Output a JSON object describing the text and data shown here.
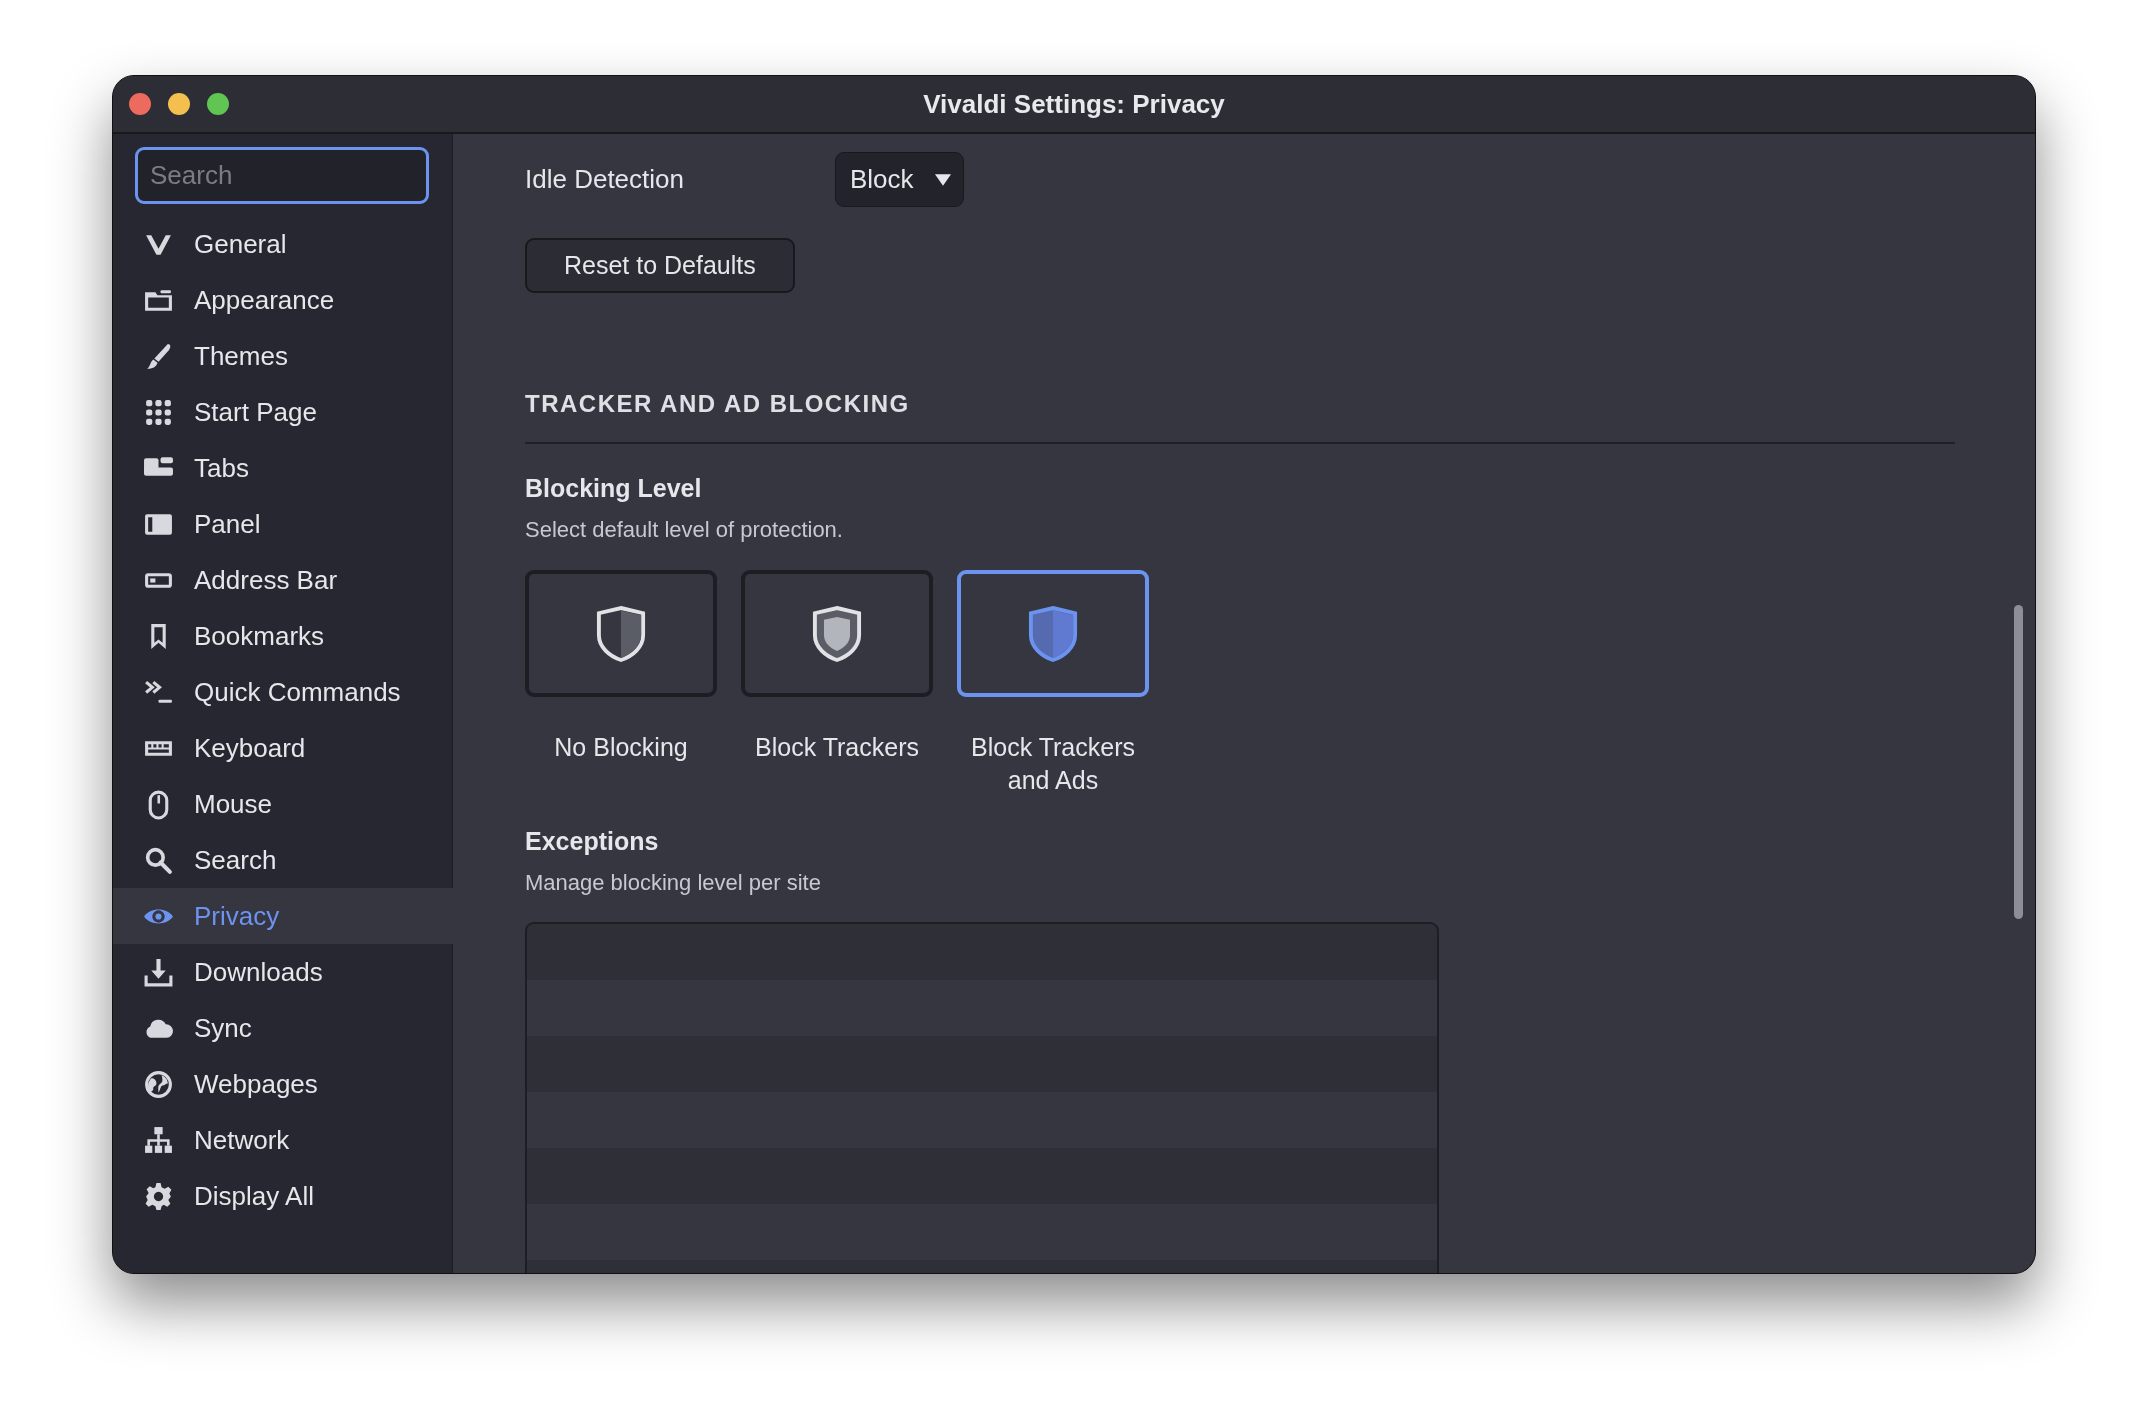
{
  "window": {
    "title": "Vivaldi Settings: Privacy"
  },
  "sidebar": {
    "search": {
      "placeholder": "Search"
    },
    "items": [
      {
        "label": "General",
        "selected": false
      },
      {
        "label": "Appearance",
        "selected": false
      },
      {
        "label": "Themes",
        "selected": false
      },
      {
        "label": "Start Page",
        "selected": false
      },
      {
        "label": "Tabs",
        "selected": false
      },
      {
        "label": "Panel",
        "selected": false
      },
      {
        "label": "Address Bar",
        "selected": false
      },
      {
        "label": "Bookmarks",
        "selected": false
      },
      {
        "label": "Quick Commands",
        "selected": false
      },
      {
        "label": "Keyboard",
        "selected": false
      },
      {
        "label": "Mouse",
        "selected": false
      },
      {
        "label": "Search",
        "selected": false
      },
      {
        "label": "Privacy",
        "selected": true
      },
      {
        "label": "Downloads",
        "selected": false
      },
      {
        "label": "Sync",
        "selected": false
      },
      {
        "label": "Webpages",
        "selected": false
      },
      {
        "label": "Network",
        "selected": false
      },
      {
        "label": "Display All",
        "selected": false
      }
    ]
  },
  "permission": {
    "label": "Idle Detection",
    "value": "Block"
  },
  "reset_button": "Reset to Defaults",
  "section": {
    "heading": "TRACKER AND AD BLOCKING",
    "blocking_level": {
      "title": "Blocking Level",
      "description": "Select default level of protection.",
      "options": [
        {
          "kind": "none",
          "label": "No Blocking",
          "selected": false
        },
        {
          "kind": "trackers",
          "label": "Block Trackers",
          "selected": false
        },
        {
          "kind": "ads",
          "label": "Block Trackers and Ads",
          "selected": true
        }
      ]
    },
    "exceptions": {
      "title": "Exceptions",
      "description": "Manage blocking level per site"
    }
  }
}
